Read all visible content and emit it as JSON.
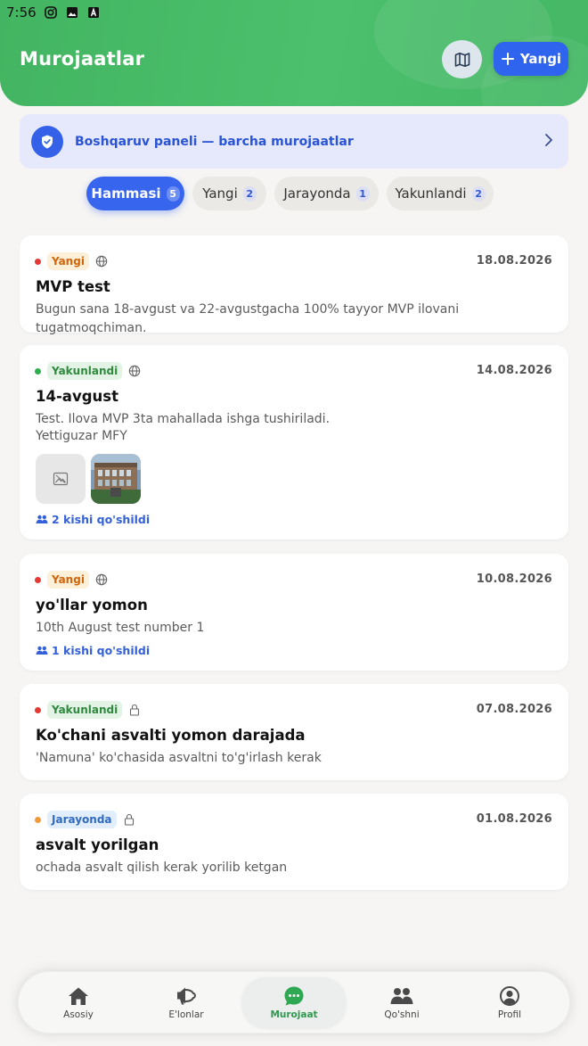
{
  "statusbar": {
    "time": "7:56",
    "icons": [
      "instagram-icon",
      "gallery-icon",
      "app-icon"
    ]
  },
  "header": {
    "title": "Murojaatlar",
    "new_button": "Yangi",
    "map_icon": "map-icon"
  },
  "admin_banner": {
    "text": "Boshqaruv paneli — barcha murojaatlar"
  },
  "filters": [
    {
      "label": "Hammasi",
      "count": "5",
      "active": true
    },
    {
      "label": "Yangi",
      "count": "2",
      "active": false
    },
    {
      "label": "Jarayonda",
      "count": "1",
      "active": false
    },
    {
      "label": "Yakunlandi",
      "count": "2",
      "active": false
    }
  ],
  "cards": [
    {
      "status": "Yangi",
      "visibility": "globe-icon",
      "date": "18.08.2026",
      "title": "MVP test",
      "desc": "Bugun sana 18-avgust va 22-avgustgacha 100% tayyor MVP ilovani tugatmoqchiman."
    },
    {
      "status": "Yakunlandi",
      "visibility": "globe-icon",
      "date": "14.08.2026",
      "title": "14-avgust",
      "desc": "Test. Ilova MVP 3ta mahallada ishga tushiriladi.",
      "mahalla": "Yettiguzar MFY",
      "joined": "2 kishi qo'shildi"
    },
    {
      "status": "Yangi",
      "visibility": "globe-icon",
      "date": "10.08.2026",
      "title": "yo'llar yomon",
      "desc": "10th August test number 1",
      "joined": "1 kishi qo'shildi"
    },
    {
      "status": "Yakunlandi",
      "visibility": "lock-icon",
      "date": "07.08.2026",
      "title": "Ko'chani asvalti yomon darajada",
      "desc": "'Namuna' ko'chasida asvaltni to'g'irlash kerak"
    },
    {
      "status": "Jarayonda",
      "visibility": "lock-icon",
      "date": "01.08.2026",
      "title": "asvalt yorilgan",
      "desc": "ochada asvalt qilish kerak yorilib ketgan"
    }
  ],
  "colors": {
    "brand_green": "#43b562",
    "primary_blue": "#2f64ee",
    "dot_red": "#e53935",
    "dot_green": "#2fae4f",
    "dot_orange": "#f29a3a"
  },
  "nav": [
    {
      "label": "Asosiy",
      "icon": "home-icon"
    },
    {
      "label": "E'lonlar",
      "icon": "megaphone-icon"
    },
    {
      "label": "Murojaat",
      "icon": "chat-icon",
      "active": true
    },
    {
      "label": "Qo'shni",
      "icon": "neighbors-icon"
    },
    {
      "label": "Profil",
      "icon": "profile-icon"
    }
  ]
}
